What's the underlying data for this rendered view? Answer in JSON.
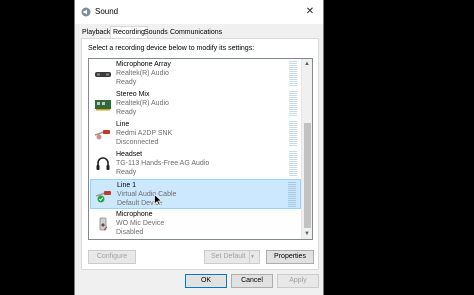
{
  "window": {
    "title": "Sound",
    "close_glyph": "✕"
  },
  "tabs": [
    {
      "label": "Playback"
    },
    {
      "label": "Recording",
      "active": true
    },
    {
      "label": "Sounds"
    },
    {
      "label": "Communications"
    }
  ],
  "instructions": "Select a recording device below to modify its settings:",
  "devices": [
    {
      "name": "Microphone Array",
      "desc": "Realtek(R) Audio",
      "status": "Ready",
      "icon": "microphone-array-icon"
    },
    {
      "name": "Stereo Mix",
      "desc": "Realtek(R) Audio",
      "status": "Ready",
      "icon": "sound-card-icon"
    },
    {
      "name": "Line",
      "desc": "Redmi A2DP SNK",
      "status": "Disconnected",
      "icon": "line-in-icon"
    },
    {
      "name": "Headset",
      "desc": "TG-113 Hands-Free AG Audio",
      "status": "Ready",
      "icon": "headset-icon"
    },
    {
      "name": "Line 1",
      "desc": "Virtual Audio Cable",
      "status": "Default Device",
      "icon": "line-in-default-icon",
      "selected": true
    },
    {
      "name": "Microphone",
      "desc": "WO Mic Device",
      "status": "Disabled",
      "icon": "microphone-icon"
    }
  ],
  "buttons": {
    "configure": "Configure",
    "set_default": "Set Default",
    "properties": "Properties",
    "ok": "OK",
    "cancel": "Cancel",
    "apply": "Apply"
  },
  "colors": {
    "selection": "#cce8ff",
    "accent": "#0078d7",
    "default_check": "#1ea83c"
  }
}
